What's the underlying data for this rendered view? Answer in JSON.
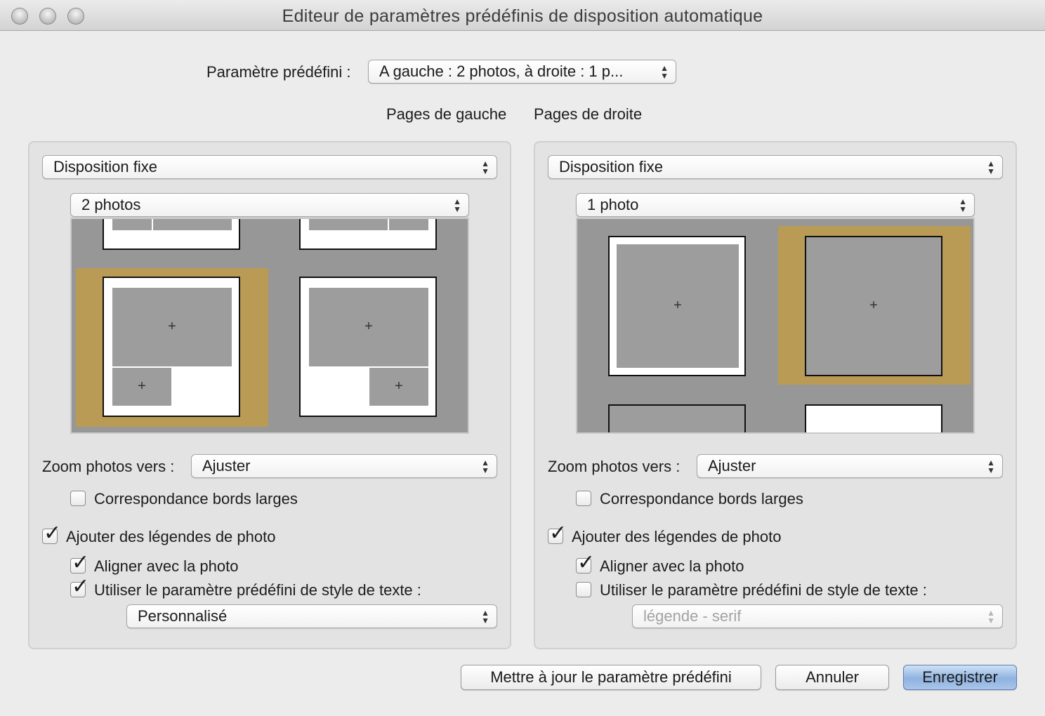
{
  "window": {
    "title": "Editeur de paramètres prédéfinis de disposition automatique"
  },
  "preset": {
    "label": "Paramètre prédéfini :",
    "value": "A gauche : 2 photos, à droite : 1 p..."
  },
  "headers": {
    "left": "Pages de gauche",
    "right": "Pages de droite"
  },
  "left": {
    "mode": "Disposition fixe",
    "layout": "2 photos",
    "zoom_label": "Zoom photos vers :",
    "zoom_value": "Ajuster",
    "match_borders": {
      "label": "Correspondance bords larges",
      "checked": false
    },
    "add_captions": {
      "label": "Ajouter des légendes de photo",
      "checked": true
    },
    "align_photo": {
      "label": "Aligner avec la photo",
      "checked": true
    },
    "use_text_style": {
      "label": "Utiliser le paramètre prédéfini de style de texte :",
      "checked": true
    },
    "text_style": "Personnalisé"
  },
  "right": {
    "mode": "Disposition fixe",
    "layout": "1 photo",
    "zoom_label": "Zoom photos vers :",
    "zoom_value": "Ajuster",
    "match_borders": {
      "label": "Correspondance bords larges",
      "checked": false
    },
    "add_captions": {
      "label": "Ajouter des légendes de photo",
      "checked": true
    },
    "align_photo": {
      "label": "Aligner avec la photo",
      "checked": true
    },
    "use_text_style": {
      "label": "Utiliser le paramètre prédéfini de style de texte :",
      "checked": false
    },
    "text_style": "légende - serif"
  },
  "preview": {
    "plus_glyph": "+",
    "check_glyph": "✓",
    "selection_color": "#b99b55"
  },
  "buttons": {
    "update": "Mettre à jour le paramètre prédéfini",
    "cancel": "Annuler",
    "save": "Enregistrer"
  }
}
